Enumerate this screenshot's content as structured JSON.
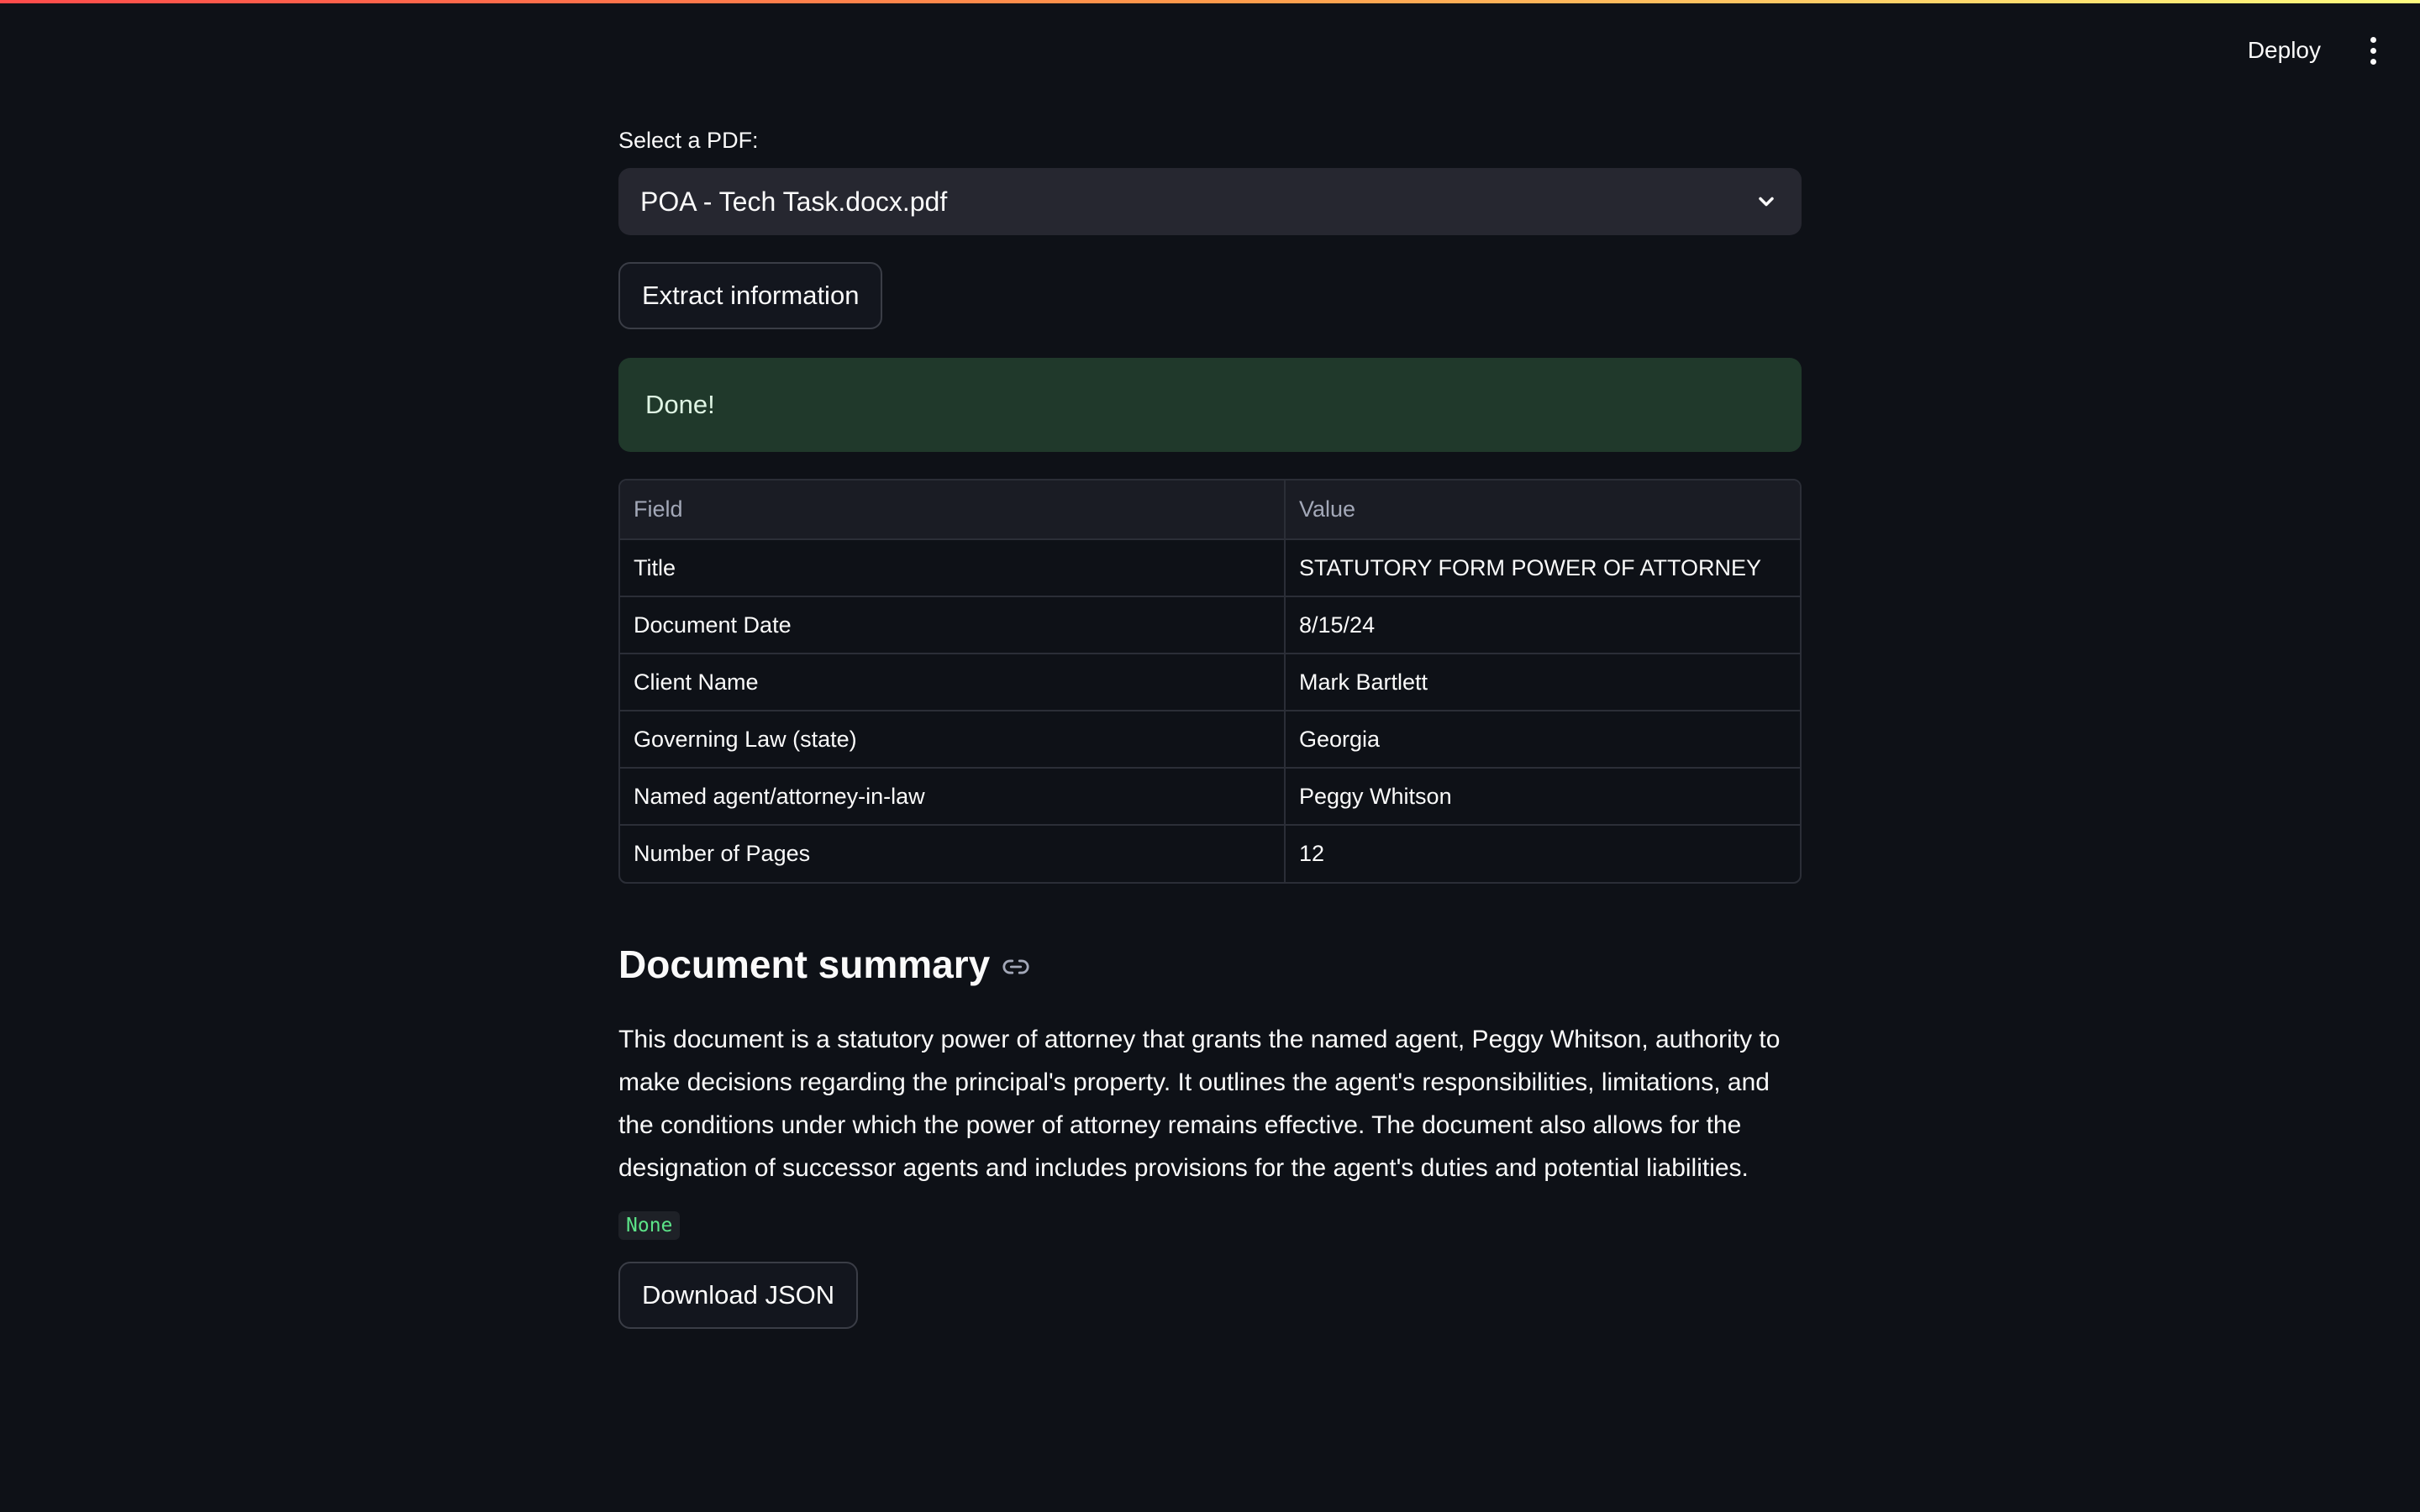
{
  "header": {
    "deploy_label": "Deploy",
    "menu_icon": "more-vertical-icon"
  },
  "pdf_select": {
    "label": "Select a PDF:",
    "selected_value": "POA - Tech Task.docx.pdf",
    "chevron_icon": "chevron-down-icon"
  },
  "extract_button": {
    "label": "Extract information"
  },
  "status": {
    "message": "Done!",
    "color": "#20392b"
  },
  "table": {
    "headers": [
      "Field",
      "Value"
    ],
    "rows": [
      {
        "field": "Title",
        "value": "STATUTORY FORM POWER OF ATTORNEY"
      },
      {
        "field": "Document Date",
        "value": "8/15/24"
      },
      {
        "field": "Client Name",
        "value": "Mark Bartlett"
      },
      {
        "field": "Governing Law (state)",
        "value": "Georgia"
      },
      {
        "field": "Named agent/attorney-in-law",
        "value": "Peggy Whitson"
      },
      {
        "field": "Number of Pages",
        "value": "12"
      }
    ]
  },
  "summary": {
    "heading": "Document summary",
    "anchor_icon": "link-icon",
    "text": "This document is a statutory power of attorney that grants the named agent, Peggy Whitson, authority to make decisions regarding the principal's property. It outlines the agent's responsibilities, limitations, and the conditions under which the power of attorney remains effective. The document also allows for the designation of successor agents and includes provisions for the agent's duties and potential liabilities."
  },
  "code_output": "None",
  "download_button": {
    "label": "Download JSON"
  },
  "colors": {
    "background": "#0e1117",
    "success_background": "#20392b",
    "code_text": "#5ce488"
  }
}
